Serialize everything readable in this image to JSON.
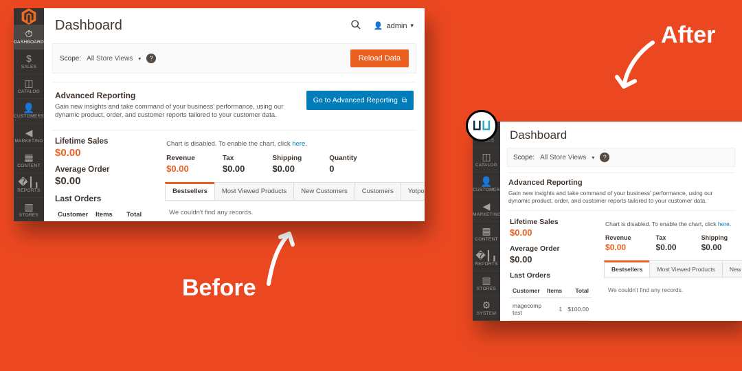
{
  "anno": {
    "before": "Before",
    "after": "After"
  },
  "sidebar": {
    "items": [
      {
        "icon": "⌨",
        "label": "DASHBOARD",
        "name": "dashboard"
      },
      {
        "icon": "$",
        "label": "SALES",
        "name": "sales"
      },
      {
        "icon": "◧",
        "label": "CATALOG",
        "name": "catalog"
      },
      {
        "icon": "👤",
        "label": "CUSTOMERS",
        "name": "customers"
      },
      {
        "icon": "📣",
        "label": "MARKETING",
        "name": "marketing"
      },
      {
        "icon": "▦",
        "label": "CONTENT",
        "name": "content"
      },
      {
        "icon": "📊",
        "label": "REPORTS",
        "name": "reports"
      },
      {
        "icon": "▤",
        "label": "STORES",
        "name": "stores"
      },
      {
        "icon": "⚙",
        "label": "SYSTEM",
        "name": "system"
      }
    ]
  },
  "header": {
    "title": "Dashboard",
    "user": "admin"
  },
  "scope": {
    "label": "Scope:",
    "selected": "All Store Views",
    "reload": "Reload Data"
  },
  "advanced": {
    "title": "Advanced Reporting",
    "body": "Gain new insights and take command of your business' performance, using our dynamic product, order, and customer reports tailored to your customer data.",
    "cta": "Go to Advanced Reporting"
  },
  "leftstats": {
    "lifetime_label": "Lifetime Sales",
    "lifetime_value": "$0.00",
    "avg_label": "Average Order",
    "avg_value": "$0.00"
  },
  "chartmsg": {
    "pre": "Chart is disabled. To enable the chart, click ",
    "link": "here",
    "post": "."
  },
  "stats": {
    "revenue_k": "Revenue",
    "revenue_v": "$0.00",
    "tax_k": "Tax",
    "tax_v": "$0.00",
    "shipping_k": "Shipping",
    "shipping_v": "$0.00",
    "qty_k": "Quantity",
    "qty_v": "0"
  },
  "lastorders": {
    "title": "Last Orders",
    "col_customer": "Customer",
    "col_items": "Items",
    "col_total": "Total",
    "row": {
      "customer": "magecomp test",
      "items": "1",
      "total": "$100.00"
    }
  },
  "tabs": {
    "items": [
      "Bestsellers",
      "Most Viewed Products",
      "New Customers",
      "Customers",
      "Yotpo Reviews"
    ],
    "empty": "We couldn't find any records."
  }
}
